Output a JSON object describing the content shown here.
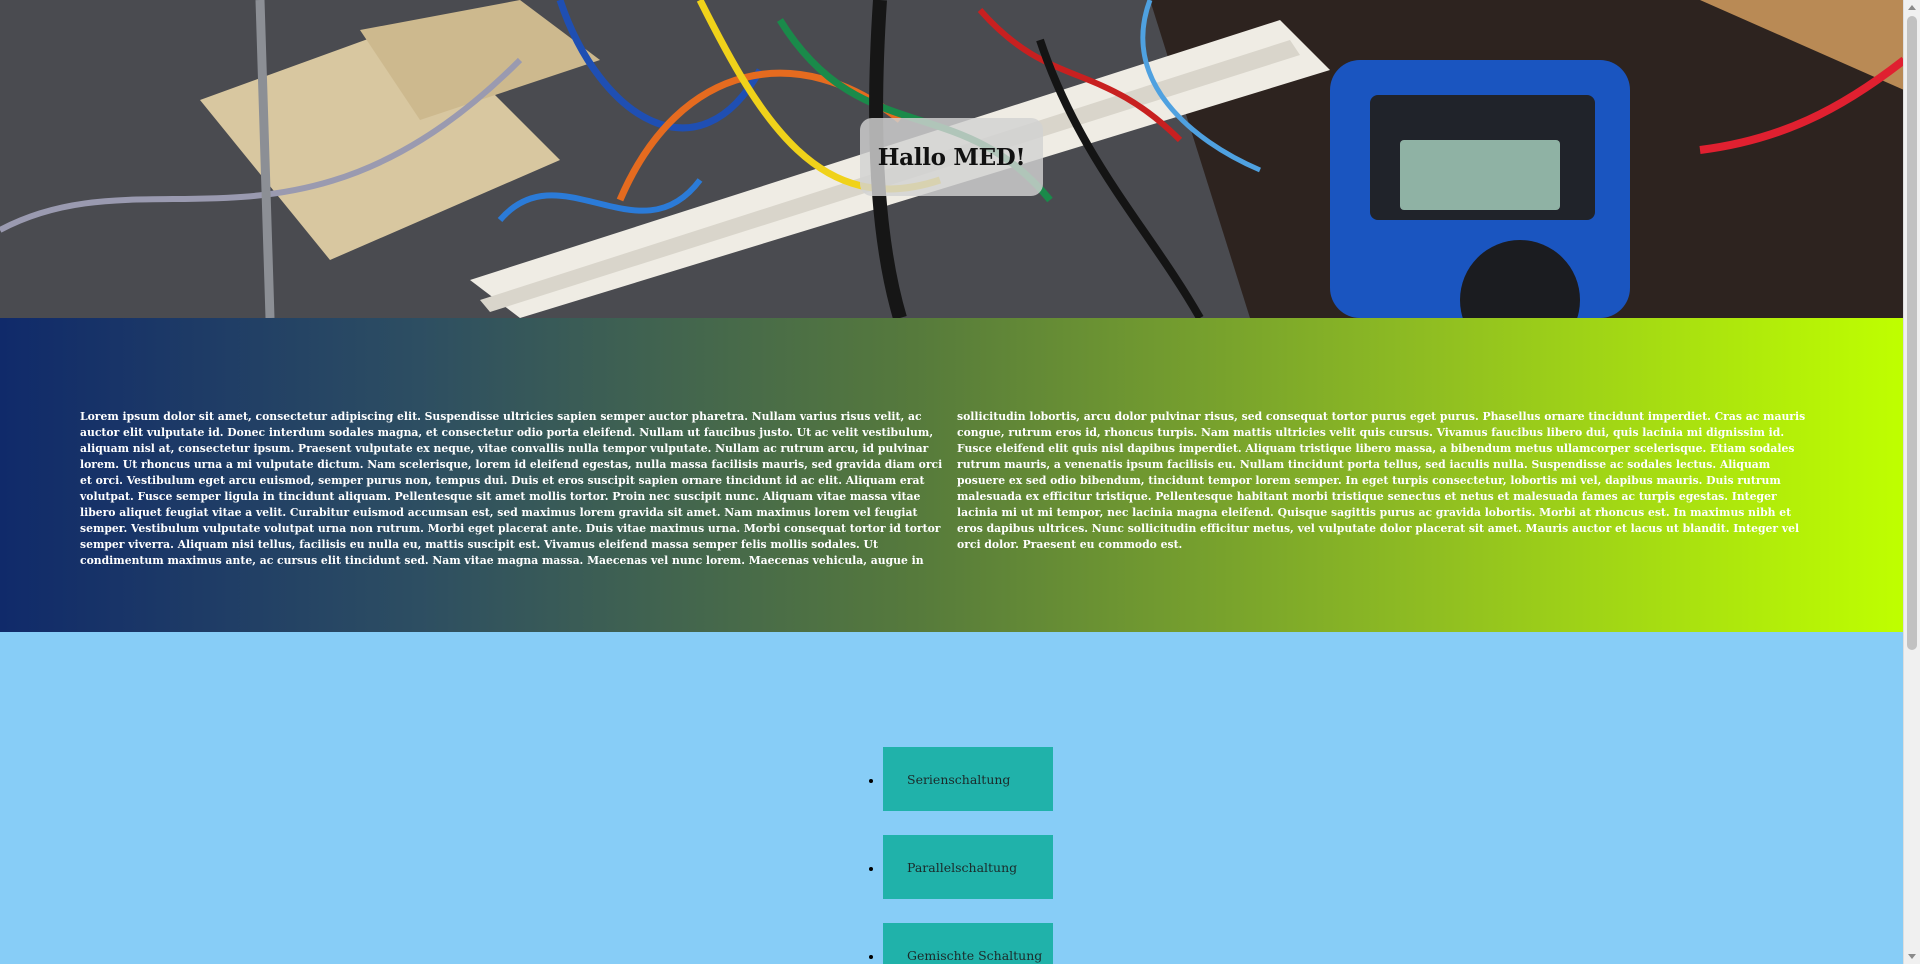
{
  "hero": {
    "title": "Hallo MED!",
    "image_alt": "electronics-breadboard-photo"
  },
  "text": {
    "body": "Lorem ipsum dolor sit amet, consectetur adipiscing elit. Suspendisse ultricies sapien semper auctor pharetra. Nullam varius risus velit, ac auctor elit vulputate id. Donec interdum sodales magna, et consectetur odio porta eleifend. Nullam ut faucibus justo. Ut ac velit vestibulum, aliquam nisl at, consectetur ipsum. Praesent vulputate ex neque, vitae convallis nulla tempor vulputate. Nullam ac rutrum arcu, id pulvinar lorem. Ut rhoncus urna a mi vulputate dictum. Nam scelerisque, lorem id eleifend egestas, nulla massa facilisis mauris, sed gravida diam orci et orci. Vestibulum eget arcu euismod, semper purus non, tempus dui. Duis et eros suscipit sapien ornare tincidunt id ac elit. Aliquam erat volutpat. Fusce semper ligula in tincidunt aliquam. Pellentesque sit amet mollis tortor. Proin nec suscipit nunc. Aliquam vitae massa vitae libero aliquet feugiat vitae a velit. Curabitur euismod accumsan est, sed maximus lorem gravida sit amet. Nam maximus lorem vel feugiat semper. Vestibulum vulputate volutpat urna non rutrum. Morbi eget placerat ante. Duis vitae maximus urna. Morbi consequat tortor id tortor semper viverra. Aliquam nisi tellus, facilisis eu nulla eu, mattis suscipit est. Vivamus eleifend massa semper felis mollis sodales. Ut condimentum maximus ante, ac cursus elit tincidunt sed. Nam vitae magna massa. Maecenas vel nunc lorem. Maecenas vehicula, augue in sollicitudin lobortis, arcu dolor pulvinar risus, sed consequat tortor purus eget purus. Phasellus ornare tincidunt imperdiet. Cras ac mauris congue, rutrum eros id, rhoncus turpis. Nam mattis ultricies velit quis cursus. Vivamus faucibus libero dui, quis lacinia mi dignissim id. Fusce eleifend elit quis nisl dapibus imperdiet. Aliquam tristique libero massa, a bibendum metus ullamcorper scelerisque. Etiam sodales rutrum mauris, a venenatis ipsum facilisis eu. Nullam tincidunt porta tellus, sed iaculis nulla. Suspendisse ac sodales lectus. Aliquam posuere ex sed odio bibendum, tincidunt tempor lorem semper. In eget turpis consectetur, lobortis mi vel, dapibus mauris. Duis rutrum malesuada ex efficitur tristique. Pellentesque habitant morbi tristique senectus et netus et malesuada fames ac turpis egestas. Integer lacinia mi ut mi tempor, nec lacinia magna eleifend. Quisque sagittis purus ac gravida lobortis. Morbi at rhoncus est. In maximus nibh et eros dapibus ultrices. Nunc sollicitudin efficitur metus, vel vulputate dolor placerat sit amet. Mauris auctor et lacus ut blandit. Integer vel orci dolor. Praesent eu commodo est."
  },
  "nav": {
    "items": [
      {
        "label": "Serienschaltung"
      },
      {
        "label": "Parallelschaltung"
      },
      {
        "label": "Gemischte Schaltung"
      }
    ]
  },
  "colors": {
    "gradient_start": "#102a6a",
    "gradient_end": "#bfff00",
    "nav_background": "#87cdf7",
    "button": "#20b2aa"
  }
}
